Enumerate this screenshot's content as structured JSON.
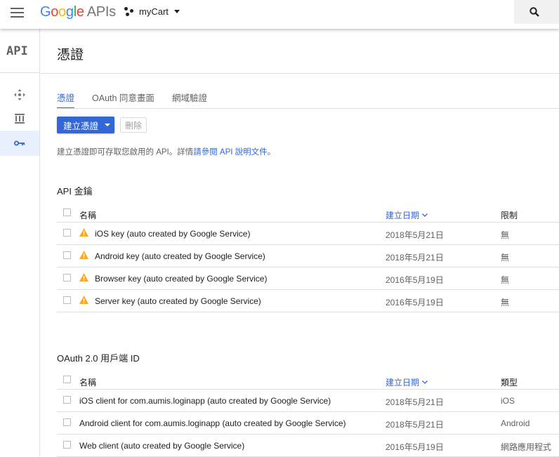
{
  "header": {
    "logo": [
      "G",
      "o",
      "o",
      "g",
      "l",
      "e"
    ],
    "logo_suffix": "APIs",
    "project_name": "myCart"
  },
  "sidebar": {
    "logo_text": "API",
    "items": [
      {
        "icon": "dashboard-icon"
      },
      {
        "icon": "library-icon"
      },
      {
        "icon": "key-icon",
        "active": true
      }
    ]
  },
  "page": {
    "title": "憑證",
    "tabs": [
      "憑證",
      "OAuth 同意畫面",
      "網域驗證"
    ],
    "create_button": "建立憑證",
    "delete_button": "刪除",
    "hint_prefix": "建立憑證即可存取您啟用的 API。詳情",
    "hint_link": "請參閱 API 說明文件",
    "hint_suffix": "。"
  },
  "api_keys": {
    "title": "API 金鑰",
    "columns": [
      "名稱",
      "建立日期",
      "限制"
    ],
    "rows": [
      {
        "name": "iOS key (auto created by Google Service)",
        "date": "2018年5月21日",
        "restriction": "無"
      },
      {
        "name": "Android key (auto created by Google Service)",
        "date": "2018年5月21日",
        "restriction": "無"
      },
      {
        "name": "Browser key (auto created by Google Service)",
        "date": "2016年5月19日",
        "restriction": "無"
      },
      {
        "name": "Server key (auto created by Google Service)",
        "date": "2016年5月19日",
        "restriction": "無"
      }
    ]
  },
  "oauth": {
    "title": "OAuth 2.0 用戶端 ID",
    "columns": [
      "名稱",
      "建立日期",
      "類型"
    ],
    "rows": [
      {
        "name": "iOS client for com.aumis.loginapp (auto created by Google Service)",
        "date": "2018年5月21日",
        "type": "iOS"
      },
      {
        "name": "Android client for com.aumis.loginapp (auto created by Google Service)",
        "date": "2018年5月21日",
        "type": "Android"
      },
      {
        "name": "Web client (auto created by Google Service)",
        "date": "2016年5月19日",
        "type": "網路應用程式"
      }
    ]
  },
  "colors": {
    "accent": "#3367d6",
    "warning": "#f9a825"
  }
}
